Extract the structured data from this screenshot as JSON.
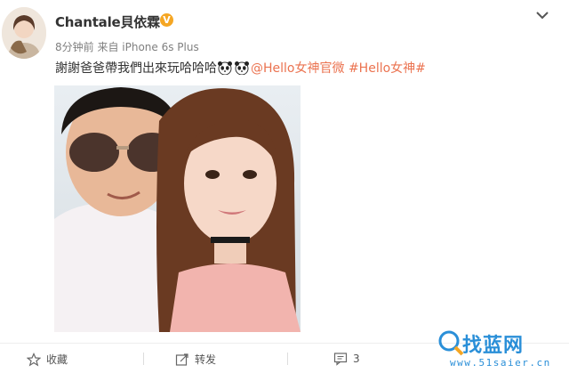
{
  "post": {
    "username": "Chantale貝依霖",
    "verified_mark": "V",
    "time": "8分钟前",
    "source": "来自 iPhone 6s Plus",
    "text": "謝謝爸爸帶我們出來玩哈哈哈",
    "emoji": [
      "panda-icon",
      "panda-icon"
    ],
    "mention": "@Hello女神官微",
    "hashtag": "#Hello女神#"
  },
  "actions": {
    "favorite_label": "收藏",
    "repost_label": "转发",
    "comment_count": "3"
  },
  "watermark": {
    "title": "找蓝网",
    "url": "www.51saier.cn"
  },
  "colors": {
    "link": "#eb7350",
    "verified": "#f5a623",
    "text": "#333333",
    "meta": "#808080",
    "watermark": "#2a8fd8"
  }
}
